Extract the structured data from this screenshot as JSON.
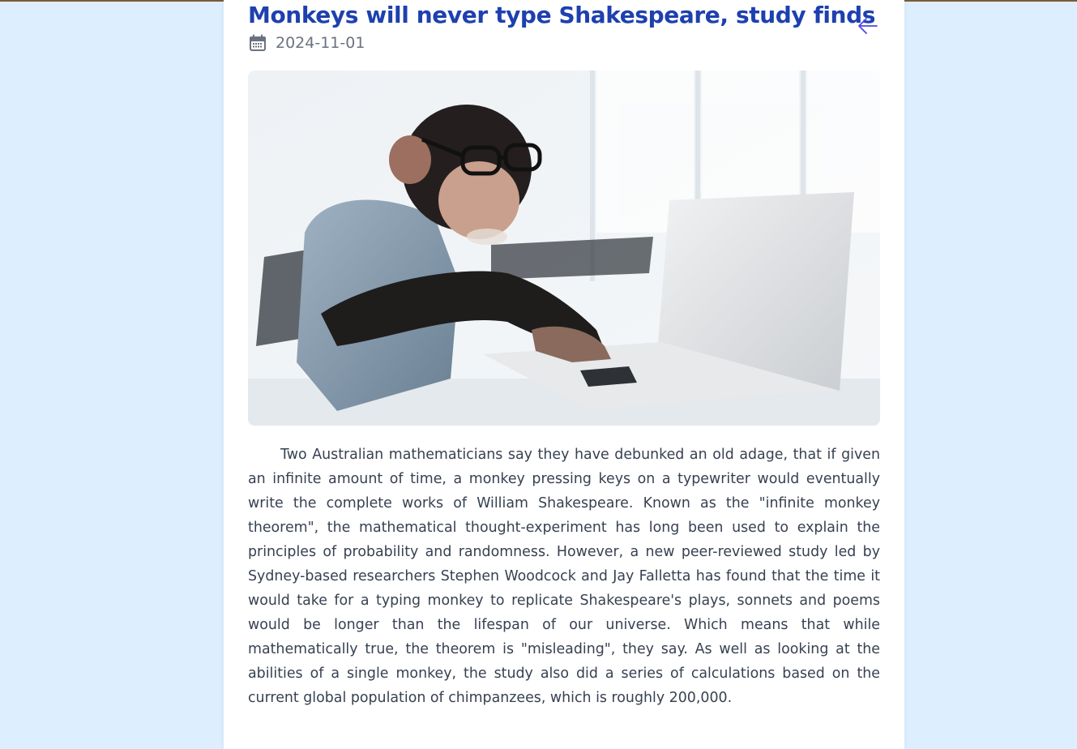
{
  "article": {
    "title": "Monkeys will never type Shakespeare, study finds",
    "date": "2024-11-01",
    "image_alt": "Chimpanzee wearing glasses typing on a laptop",
    "body": "Two Australian mathematicians say they have debunked an old adage, that if given an infinite amount of time, a monkey pressing keys on a typewriter would eventually write the complete works of William Shakespeare. Known as the \"infinite monkey theorem\", the mathematical thought-experiment has long been used to explain the principles of probability and randomness. However, a new peer-reviewed study led by Sydney-based researchers Stephen Woodcock and Jay Falletta has found that the time it would take for a typing monkey to replicate Shakespeare's plays, sonnets and poems would be longer than the lifespan of our universe. Which means that while mathematically true, the theorem is \"misleading\", they say. As well as looking at the abilities of a single monkey, the study also did a series of calculations based on the current global population of chimpanzees, which is roughly 200,000."
  },
  "icons": {
    "back": "arrow-left-icon",
    "date": "calendar-icon"
  },
  "colors": {
    "page_background": "#ddeefe",
    "card_background": "#ffffff",
    "title": "#1e40af",
    "back_arrow": "#4f46e5",
    "meta_text": "#6b7280",
    "body_text": "#374151"
  }
}
